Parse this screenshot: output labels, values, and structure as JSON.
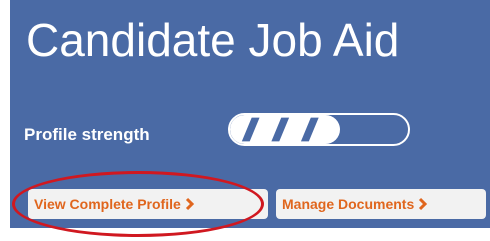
{
  "header": {
    "title": "Candidate Job Aid"
  },
  "profile": {
    "strength_label": "Profile strength",
    "strength_level": 0.62
  },
  "actions": {
    "view_profile_label": "View Complete Profile",
    "manage_documents_label": "Manage Documents"
  },
  "icons": {
    "chevron": "chevron-right-icon"
  },
  "colors": {
    "panel_background": "#4a6aa5",
    "button_text": "#e0661e",
    "button_background": "#f2f2f2",
    "highlight_ring": "#d01820"
  }
}
